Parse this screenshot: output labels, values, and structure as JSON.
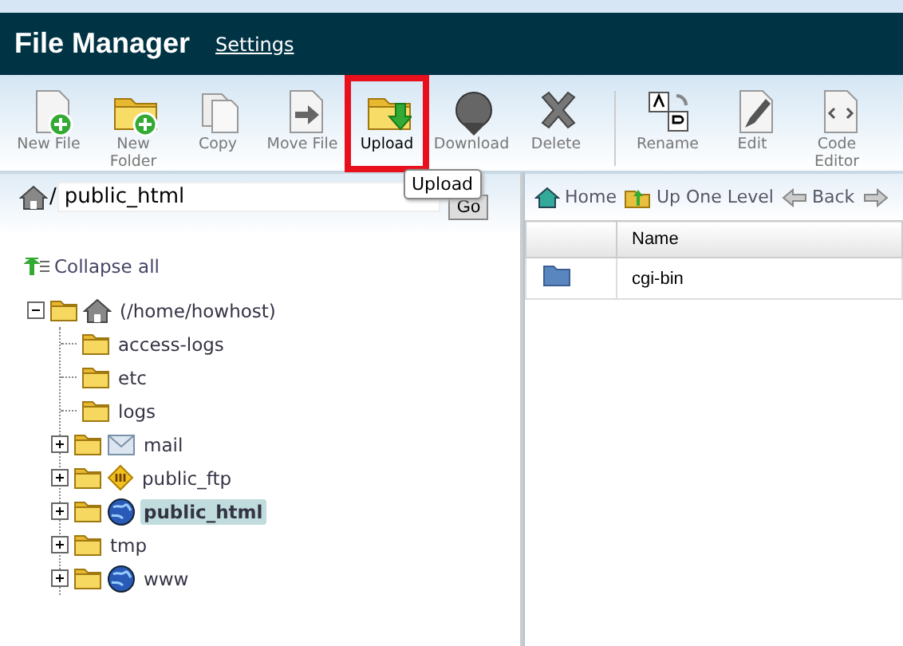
{
  "header": {
    "title": "File Manager",
    "settings_link": "Settings"
  },
  "toolbar_groups": [
    [
      {
        "label": "New File",
        "highlighted": false
      },
      {
        "label": "New Folder",
        "highlighted": false
      },
      {
        "label": "Copy",
        "highlighted": false
      },
      {
        "label": "Move File",
        "highlighted": false
      },
      {
        "label": "Upload",
        "highlighted": true
      },
      {
        "label": "Download",
        "highlighted": false
      },
      {
        "label": "Delete",
        "highlighted": false
      }
    ],
    [
      {
        "label": "Rename",
        "highlighted": false
      },
      {
        "label": "Edit",
        "highlighted": false
      },
      {
        "label": "Code Editor",
        "highlighted": false
      }
    ]
  ],
  "tooltip": "Upload",
  "path_bar": {
    "separator": "/",
    "value": "public_html",
    "go_button": "Go"
  },
  "collapse_all": "Collapse all",
  "tree": {
    "label": "(/home/howhost)",
    "expanded": true,
    "selected": false,
    "children": [
      {
        "label": "access-logs",
        "kind": "folder",
        "expandable": false,
        "selected": false
      },
      {
        "label": "etc",
        "kind": "folder",
        "expandable": false,
        "selected": false
      },
      {
        "label": "logs",
        "kind": "folder",
        "expandable": false,
        "selected": false
      },
      {
        "label": "mail",
        "kind": "mail",
        "expandable": true,
        "selected": false
      },
      {
        "label": "public_ftp",
        "kind": "ftp",
        "expandable": true,
        "selected": false
      },
      {
        "label": "public_html",
        "kind": "web",
        "expandable": true,
        "selected": true
      },
      {
        "label": "tmp",
        "kind": "folder",
        "expandable": true,
        "selected": false
      },
      {
        "label": "www",
        "kind": "web",
        "expandable": true,
        "selected": false
      }
    ]
  },
  "nav": [
    "Home",
    "Up One Level",
    "Back"
  ],
  "table": {
    "columns": [
      "Name"
    ],
    "rows": [
      {
        "name": "cgi-bin"
      }
    ]
  }
}
